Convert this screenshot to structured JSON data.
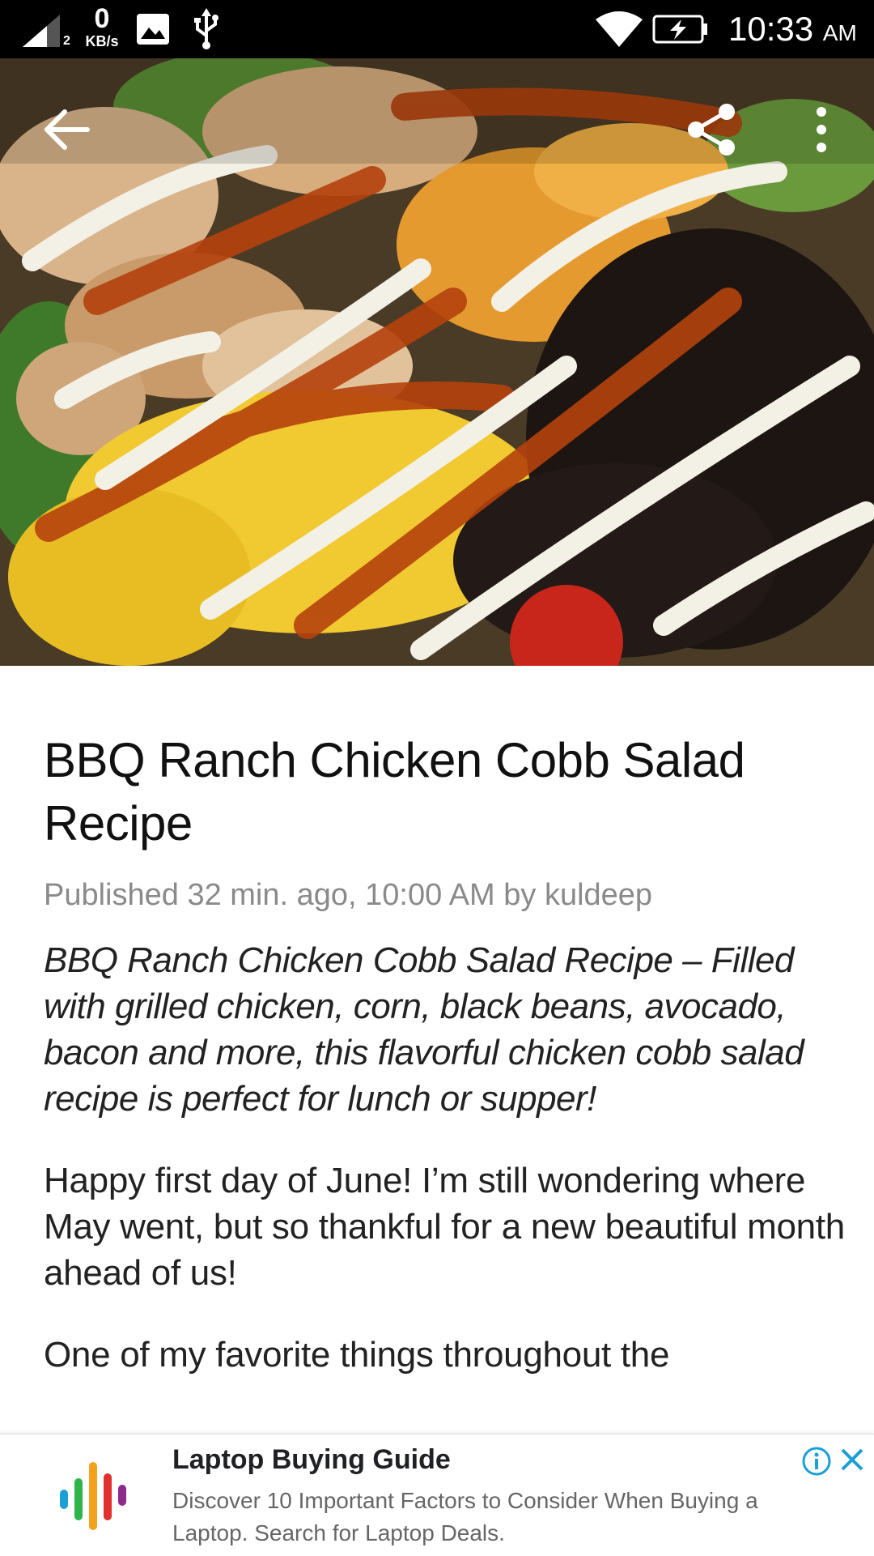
{
  "status_bar": {
    "data_rate_value": "0",
    "data_rate_unit": "KB/s",
    "sim_slot": "2",
    "time": "10:33",
    "ampm": "AM",
    "icons": [
      "signal-icon",
      "image-icon",
      "usb-icon",
      "wifi-icon",
      "battery-charging-icon"
    ]
  },
  "toolbar": {
    "icons": [
      "back-arrow-icon",
      "share-icon",
      "more-vert-icon"
    ]
  },
  "article": {
    "title": "BBQ Ranch Chicken Cobb Salad Recipe",
    "meta": "Published 32 min. ago, 10:00 AM by kuldeep",
    "lead": "BBQ Ranch Chicken Cobb Salad Recipe – Filled with grilled chicken, corn, black beans, avocado, bacon and more, this flavorful chicken cobb salad recipe is perfect for lunch or supper!",
    "paragraphs": [
      "Happy first day of June! I’m still wondering where May went, but so thankful for a new beautiful month ahead of us!",
      "One of my favorite things throughout the"
    ]
  },
  "ad": {
    "title": "Laptop Buying Guide",
    "description": "Discover 10 Important Factors to Consider When Buying a Laptop. Search for Laptop Deals.",
    "icons": [
      "ad-logo-icon",
      "ad-info-icon",
      "ad-close-icon"
    ],
    "accent": "#1a9fd6"
  }
}
